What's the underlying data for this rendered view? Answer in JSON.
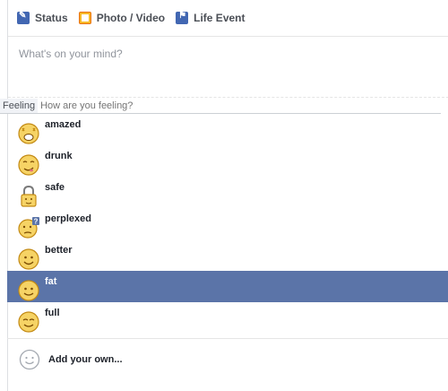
{
  "tabs": [
    {
      "label": "Status",
      "icon": "pencil-icon"
    },
    {
      "label": "Photo / Video",
      "icon": "photo-icon"
    },
    {
      "label": "Life Event",
      "icon": "flag-icon"
    }
  ],
  "composer": {
    "placeholder": "What's on your mind?"
  },
  "feeling": {
    "tag": "Feeling",
    "placeholder": "How are you feeling?"
  },
  "options": [
    {
      "label": "amazed",
      "icon": "amazed-emoji-icon"
    },
    {
      "label": "drunk",
      "icon": "drunk-emoji-icon"
    },
    {
      "label": "safe",
      "icon": "safe-lock-icon"
    },
    {
      "label": "perplexed",
      "icon": "perplexed-emoji-icon"
    },
    {
      "label": "better",
      "icon": "better-emoji-icon"
    },
    {
      "label": "fat",
      "icon": "fat-emoji-icon"
    },
    {
      "label": "full",
      "icon": "full-emoji-icon"
    }
  ],
  "selected_option": "fat",
  "colors": {
    "selected_bg": "#5b74a8",
    "emoji_fill": "#f6d365",
    "emoji_outline": "#c38a14"
  },
  "add_own": {
    "label": "Add your own..."
  }
}
